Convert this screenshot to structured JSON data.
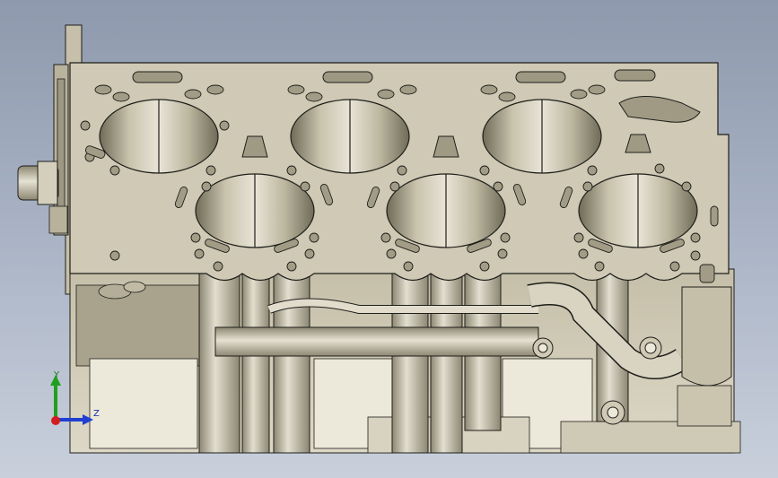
{
  "viewport": {
    "background_top": "#8e99ad",
    "background_bottom": "#c9d0dc",
    "model": "cylinder-head-cad-model",
    "material_color": "#cfc9b5",
    "edge_color": "#1e1e1a"
  },
  "triad": {
    "y_label": "Y",
    "z_label": "Z",
    "x_color": "#d21e1e",
    "y_color": "#1fa01f",
    "z_color": "#1e3fd2"
  }
}
